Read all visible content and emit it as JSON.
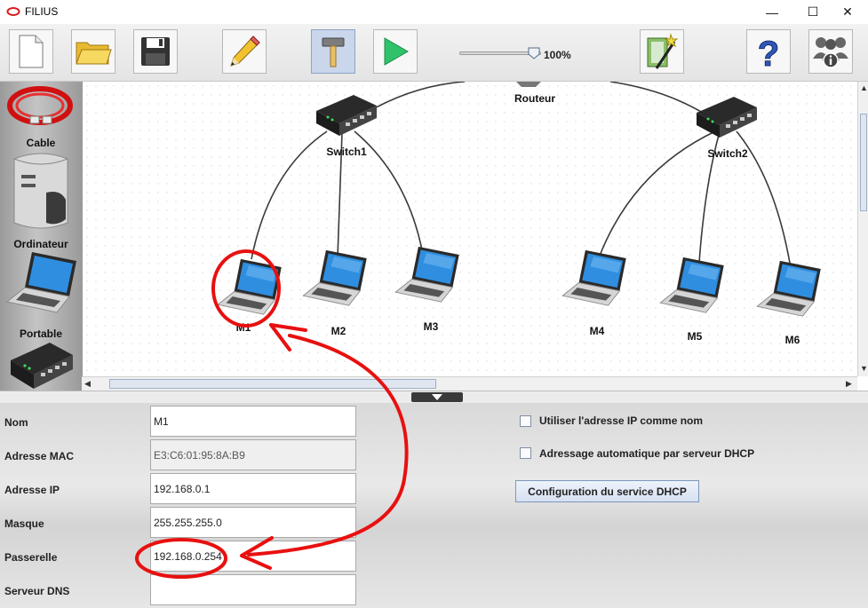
{
  "window": {
    "title": "FILIUS",
    "minimize_glyph": "—",
    "maximize_glyph": "☐",
    "close_glyph": "✕"
  },
  "toolbar": {
    "zoom_level": "100%",
    "zoom_value": 1.0,
    "icons": [
      "new-file-icon",
      "open-folder-icon",
      "save-icon",
      "pencil-icon",
      "hammer-icon",
      "play-icon",
      "wizard-icon",
      "help-icon",
      "info-icon"
    ]
  },
  "palette": {
    "items": [
      {
        "label": "Cable",
        "icon": "cable-icon"
      },
      {
        "label": "Ordinateur",
        "icon": "server-icon"
      },
      {
        "label": "Portable",
        "icon": "laptop-icon"
      },
      {
        "label": "",
        "icon": "switch-icon"
      }
    ]
  },
  "network": {
    "router": {
      "label": "Routeur"
    },
    "switches": [
      {
        "label": "Switch1"
      },
      {
        "label": "Switch2"
      }
    ],
    "laptops": [
      {
        "label": "M1"
      },
      {
        "label": "M2"
      },
      {
        "label": "M3"
      },
      {
        "label": "M4"
      },
      {
        "label": "M5"
      },
      {
        "label": "M6"
      }
    ]
  },
  "properties": {
    "nom": {
      "label": "Nom",
      "value": "M1"
    },
    "mac": {
      "label": "Adresse MAC",
      "value": "E3:C6:01:95:8A:B9"
    },
    "ip": {
      "label": "Adresse IP",
      "value": "192.168.0.1"
    },
    "masque": {
      "label": "Masque",
      "value": "255.255.255.0"
    },
    "passerelle": {
      "label": "Passerelle",
      "value": "192.168.0.254"
    },
    "dns": {
      "label": "Serveur DNS",
      "value": ""
    },
    "use_ip_as_name": {
      "label": "Utiliser l'adresse IP comme nom",
      "checked": false
    },
    "dhcp_auto": {
      "label": "Adressage automatique par serveur DHCP",
      "checked": false
    },
    "dhcp_config_button": "Configuration du service DHCP"
  },
  "colors": {
    "annotation": "#e81010",
    "accent": "#3b78c4"
  }
}
